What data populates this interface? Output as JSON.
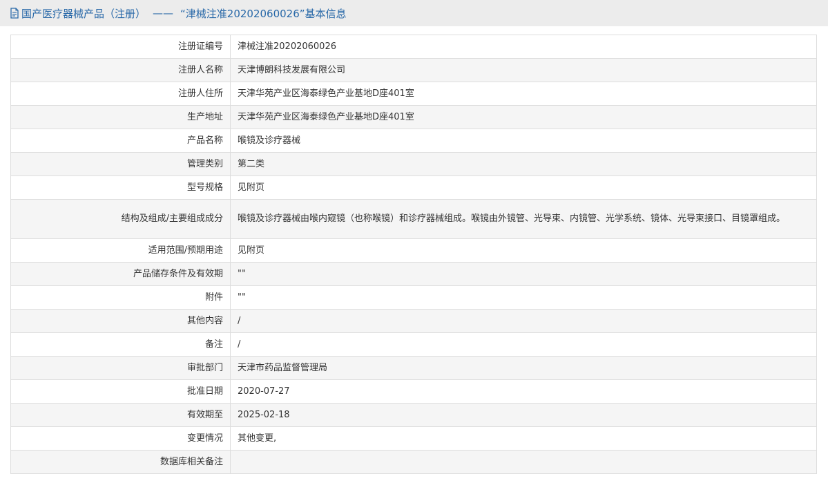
{
  "header": {
    "category": "国产医疗器械产品（注册）",
    "separator": "——",
    "record_title": "“津械注准20202060026”基本信息"
  },
  "rows": [
    {
      "label": "注册证编号",
      "value": "津械注准20202060026"
    },
    {
      "label": "注册人名称",
      "value": "天津博朗科技发展有限公司"
    },
    {
      "label": "注册人住所",
      "value": "天津华苑产业区海泰绿色产业基地D座401室"
    },
    {
      "label": "生产地址",
      "value": "天津华苑产业区海泰绿色产业基地D座401室"
    },
    {
      "label": "产品名称",
      "value": "喉镜及诊疗器械"
    },
    {
      "label": "管理类别",
      "value": "第二类"
    },
    {
      "label": "型号规格",
      "value": "见附页"
    },
    {
      "label": "结构及组成/主要组成成分",
      "value": "喉镜及诊疗器械由喉内窥镜（也称喉镜）和诊疗器械组成。喉镜由外镜管、光导束、内镜管、光学系统、镜体、光导束接口、目镜罩组成。"
    },
    {
      "label": "适用范围/预期用途",
      "value": "见附页"
    },
    {
      "label": "产品储存条件及有效期",
      "value": "\"\""
    },
    {
      "label": "附件",
      "value": "\"\""
    },
    {
      "label": "其他内容",
      "value": "/"
    },
    {
      "label": "备注",
      "value": "/"
    },
    {
      "label": "审批部门",
      "value": "天津市药品监督管理局"
    },
    {
      "label": "批准日期",
      "value": "2020-07-27"
    },
    {
      "label": "有效期至",
      "value": "2025-02-18"
    },
    {
      "label": "变更情况",
      "value": "其他变更,"
    },
    {
      "label": "数据库相关备注",
      "value": ""
    }
  ]
}
